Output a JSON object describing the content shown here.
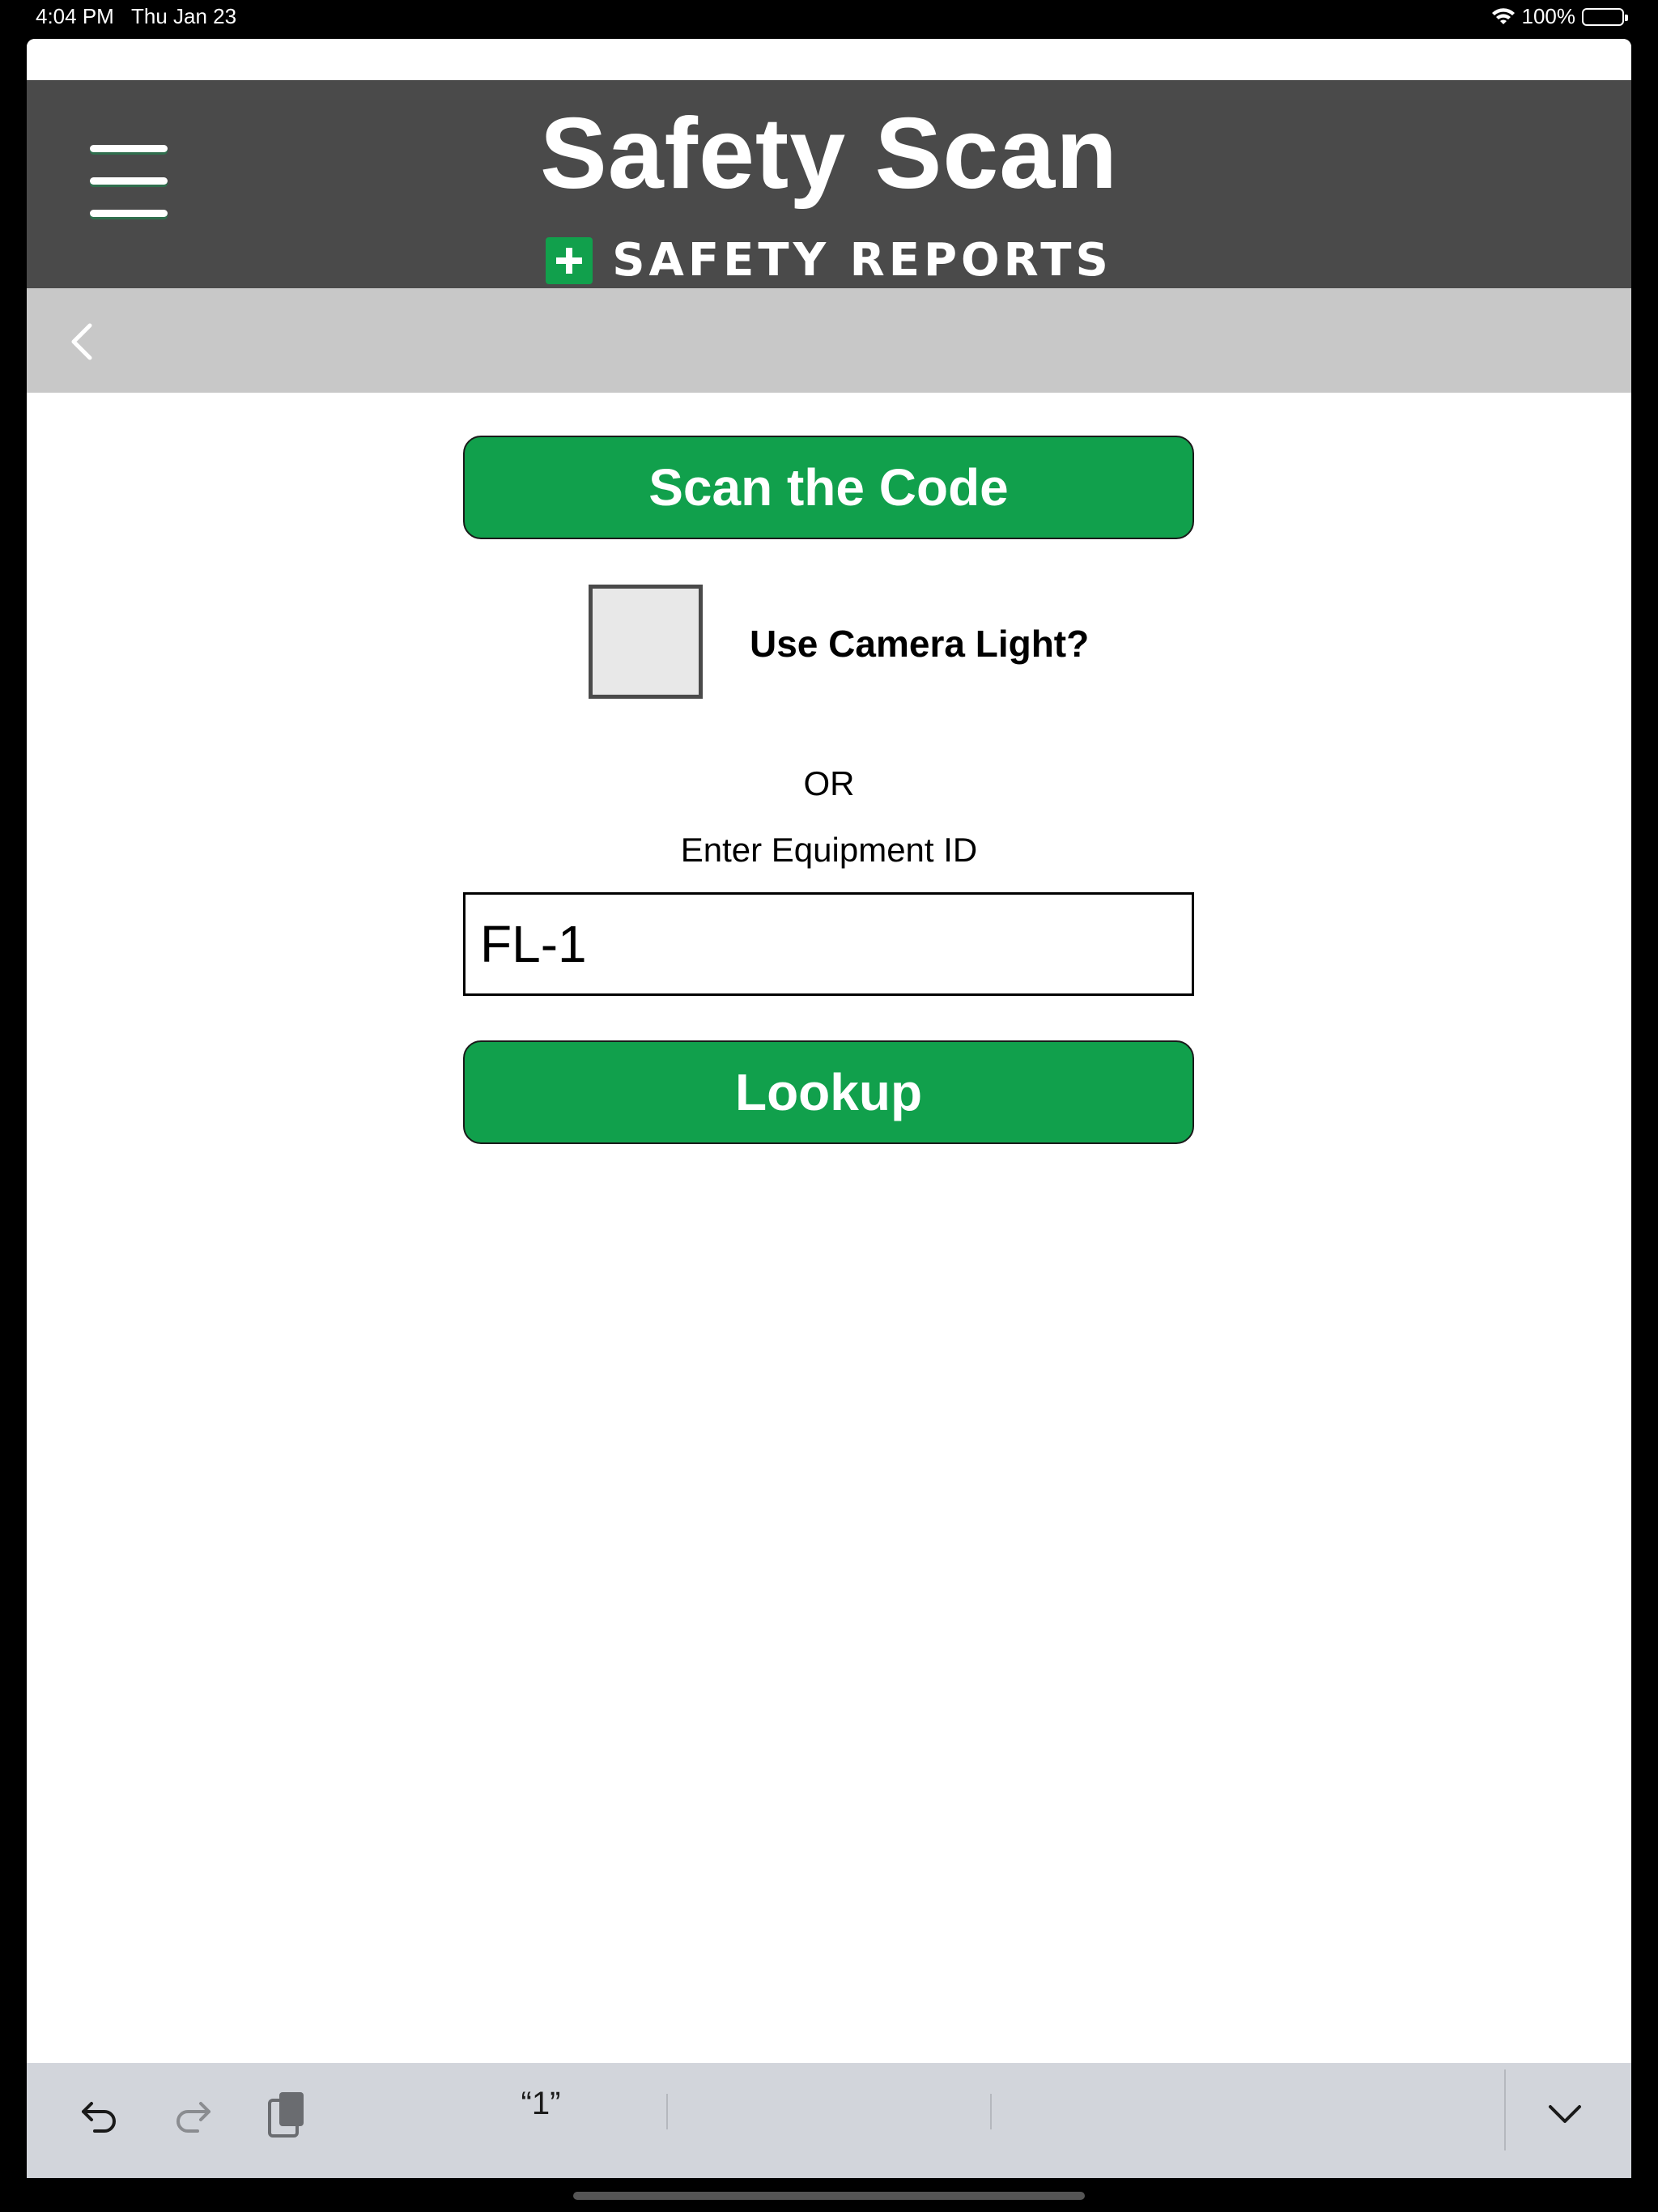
{
  "status_bar": {
    "time": "4:04 PM",
    "date": "Thu Jan 23",
    "battery": "100%"
  },
  "header": {
    "title": "Safety Scan",
    "brand": "SAFETY REPORTS"
  },
  "main": {
    "scan_button": "Scan the Code",
    "camera_light_label": "Use Camera Light?",
    "camera_light_checked": false,
    "or_text": "OR",
    "equipment_label": "Enter Equipment ID",
    "equipment_value": "FL-1",
    "lookup_button": "Lookup"
  },
  "keyboard_bar": {
    "suggestion": "“1”"
  },
  "colors": {
    "header_bg": "#4a4a4a",
    "nav_bg": "#c8c8c8",
    "accent_green": "#11a04c"
  }
}
